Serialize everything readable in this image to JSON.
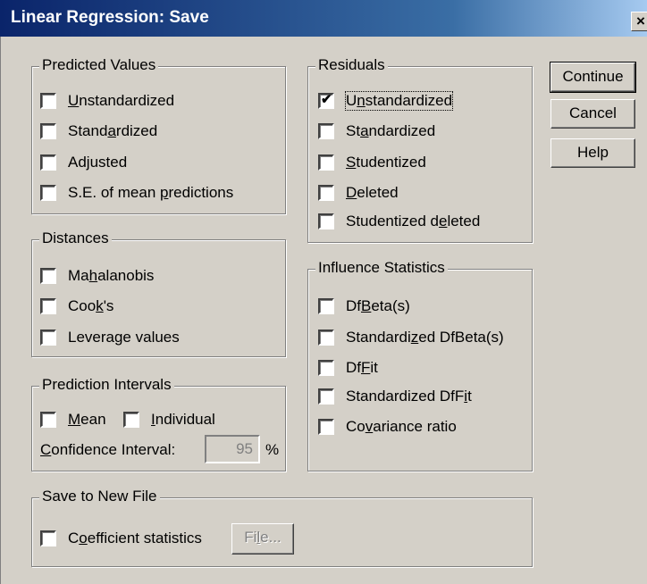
{
  "window": {
    "title": "Linear Regression: Save",
    "close_glyph": "×"
  },
  "predicted_values": {
    "legend": "Predicted Values",
    "items": [
      {
        "pre": "",
        "ul": "U",
        "post": "nstandardized",
        "checked": false
      },
      {
        "pre": "Stand",
        "ul": "a",
        "post": "rdized",
        "checked": false
      },
      {
        "pre": "Ad",
        "ul": "j",
        "post": "usted",
        "checked": false
      },
      {
        "pre": "S.E. of mean ",
        "ul": "p",
        "post": "redictions",
        "checked": false
      }
    ]
  },
  "distances": {
    "legend": "Distances",
    "items": [
      {
        "pre": "Ma",
        "ul": "h",
        "post": "alanobis",
        "checked": false
      },
      {
        "pre": "Coo",
        "ul": "k",
        "post": "'s",
        "checked": false
      },
      {
        "pre": "Leverage values",
        "ul": "",
        "post": "",
        "checked": false
      }
    ]
  },
  "prediction_intervals": {
    "legend": "Prediction Intervals",
    "mean": {
      "pre": "",
      "ul": "M",
      "post": "ean",
      "checked": false
    },
    "individual": {
      "pre": "",
      "ul": "I",
      "post": "ndividual",
      "checked": false
    },
    "ci_label": {
      "pre": "",
      "ul": "C",
      "post": "onfidence Interval:"
    },
    "ci_value": "95",
    "ci_unit": "%"
  },
  "residuals": {
    "legend": "Residuals",
    "items": [
      {
        "pre": "U",
        "ul": "n",
        "post": "standardized",
        "checked": true,
        "mark": "✔"
      },
      {
        "pre": "St",
        "ul": "a",
        "post": "ndardized",
        "checked": false
      },
      {
        "pre": "",
        "ul": "S",
        "post": "tudentized",
        "checked": false
      },
      {
        "pre": "",
        "ul": "D",
        "post": "eleted",
        "checked": false
      },
      {
        "pre": "Studentized d",
        "ul": "e",
        "post": "leted",
        "checked": false
      }
    ]
  },
  "influence": {
    "legend": "Influence Statistics",
    "items": [
      {
        "pre": "Df",
        "ul": "B",
        "post": "eta(s)",
        "checked": false
      },
      {
        "pre": "Standardi",
        "ul": "z",
        "post": "ed DfBeta(s)",
        "checked": false
      },
      {
        "pre": "Df",
        "ul": "F",
        "post": "it",
        "checked": false
      },
      {
        "pre": "Standardized DfF",
        "ul": "i",
        "post": "t",
        "checked": false
      },
      {
        "pre": "Co",
        "ul": "v",
        "post": "ariance ratio",
        "checked": false
      }
    ]
  },
  "save_file": {
    "legend": "Save to New File",
    "coef": {
      "pre": "C",
      "ul": "o",
      "post": "efficient statistics",
      "checked": false
    },
    "file_btn": {
      "pre": "Fi",
      "ul": "l",
      "post": "e..."
    }
  },
  "buttons": {
    "continue": "Continue",
    "cancel": "Cancel",
    "help": "Help"
  }
}
